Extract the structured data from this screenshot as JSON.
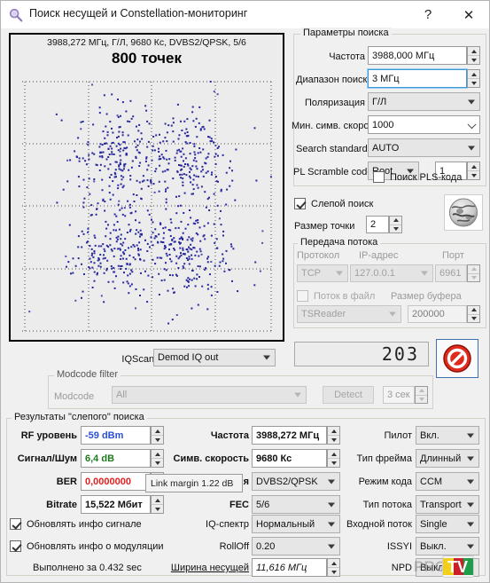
{
  "window": {
    "title": "Поиск несущей и Constellation-мониторинг",
    "icon": "magnifier-icon",
    "help_label": "?",
    "close_label": "✕"
  },
  "constellation": {
    "info_line": "3988,272 МГц, Г/Л, 9680 Кс, DVBS2/QPSK, 5/6",
    "points_label": "800 точек",
    "dot_color": "#28289e",
    "bg_color": "#ececec",
    "grid_divisions": 4
  },
  "search_params": {
    "group_title": "Параметры поиска",
    "frequency": {
      "label": "Частота",
      "value": "3988,000 МГц"
    },
    "search_range": {
      "label": "Диапазон поиска",
      "value": "3 МГц",
      "focused": true
    },
    "polarization": {
      "label": "Поляризация",
      "value": "Г/Л"
    },
    "min_symbol_rate": {
      "label": "Мин. симв. скорость",
      "value": "1000"
    },
    "search_standard": {
      "label": "Search standard",
      "value": "AUTO"
    },
    "pl_scramble": {
      "label": "PL Scramble code",
      "mode": "Root",
      "index": "1"
    },
    "pls_search": {
      "label": "Поиск PLS-кода",
      "checked": false
    }
  },
  "blind": {
    "blind_search": {
      "label": "Слепой поиск",
      "checked": true
    },
    "dot_size": {
      "label": "Размер точки",
      "value": "2"
    },
    "globe_icon": "globe-icon"
  },
  "stream": {
    "group_title": "Передача потока",
    "protocol": {
      "label": "Протокол",
      "value": "TCP"
    },
    "ip": {
      "label": "IP-адрес",
      "value": "127.0.0.1"
    },
    "port": {
      "label": "Порт",
      "value": "6961"
    },
    "to_file": {
      "label": "Поток в файл",
      "checked": false
    },
    "buffer": {
      "label": "Размер буфера",
      "value": "200000"
    },
    "writer": {
      "value": "TSReader"
    }
  },
  "counter": {
    "value": "203"
  },
  "stop_button": {
    "icon": "stop-prohibited-icon"
  },
  "iqscan": {
    "label": "IQScan point",
    "value": "Demod IQ out"
  },
  "modcode_filter": {
    "group_title": "Modcode filter",
    "modcode": {
      "label": "Modcode",
      "value": "All"
    },
    "detect_label": "Detect",
    "timeout": {
      "value": "3 сек"
    }
  },
  "results": {
    "group_title": "Результаты \"слепого\" поиска",
    "rf_level": {
      "label": "RF уровень",
      "value": "-59 dBm"
    },
    "snr": {
      "label": "Сигнал/Шум",
      "value": "6,4 dB"
    },
    "ber": {
      "label": "BER",
      "value": "0,0000000"
    },
    "bitrate": {
      "label": "Bitrate",
      "value": "15,522 Мбит"
    },
    "frequency": {
      "label": "Частота",
      "value": "3988,272 МГц"
    },
    "symbol_rate": {
      "label": "Симв. скорость",
      "value": "9680 Кс"
    },
    "modulation": {
      "label": "Модуляция",
      "value": "DVBS2/QPSK"
    },
    "fec": {
      "label": "FEC",
      "value": "5/6"
    },
    "pilot": {
      "label": "Пилот",
      "value": "Вкл."
    },
    "frame_type": {
      "label": "Тип фрейма",
      "value": "Длинный"
    },
    "code_mode": {
      "label": "Режим кода",
      "value": "CCM"
    },
    "stream_type": {
      "label": "Тип потока",
      "value": "Transport"
    },
    "update_signal": {
      "label": "Обновлять инфо сигнале",
      "checked": true
    },
    "update_modulation": {
      "label": "Обновлять инфо о модуляции",
      "checked": true
    },
    "iq_spectrum": {
      "label": "IQ-спектр",
      "value": "Нормальный"
    },
    "rolloff": {
      "label": "RollOff",
      "value": "0.20"
    },
    "input_stream": {
      "label": "Входной поток",
      "value": "Single"
    },
    "issyi": {
      "label": "ISSYI",
      "value": "Выкл."
    },
    "npd": {
      "label": "NPD",
      "value": "Выкл."
    },
    "carrier_width": {
      "label": "Ширина несущей",
      "value": "11,616 МГц"
    },
    "elapsed": "Выполнено за 0.432 sec"
  },
  "tooltip": {
    "text": "Link margin 1.22 dB"
  },
  "watermark": {
    "text": "PRO",
    "logo": "tv-logo"
  }
}
